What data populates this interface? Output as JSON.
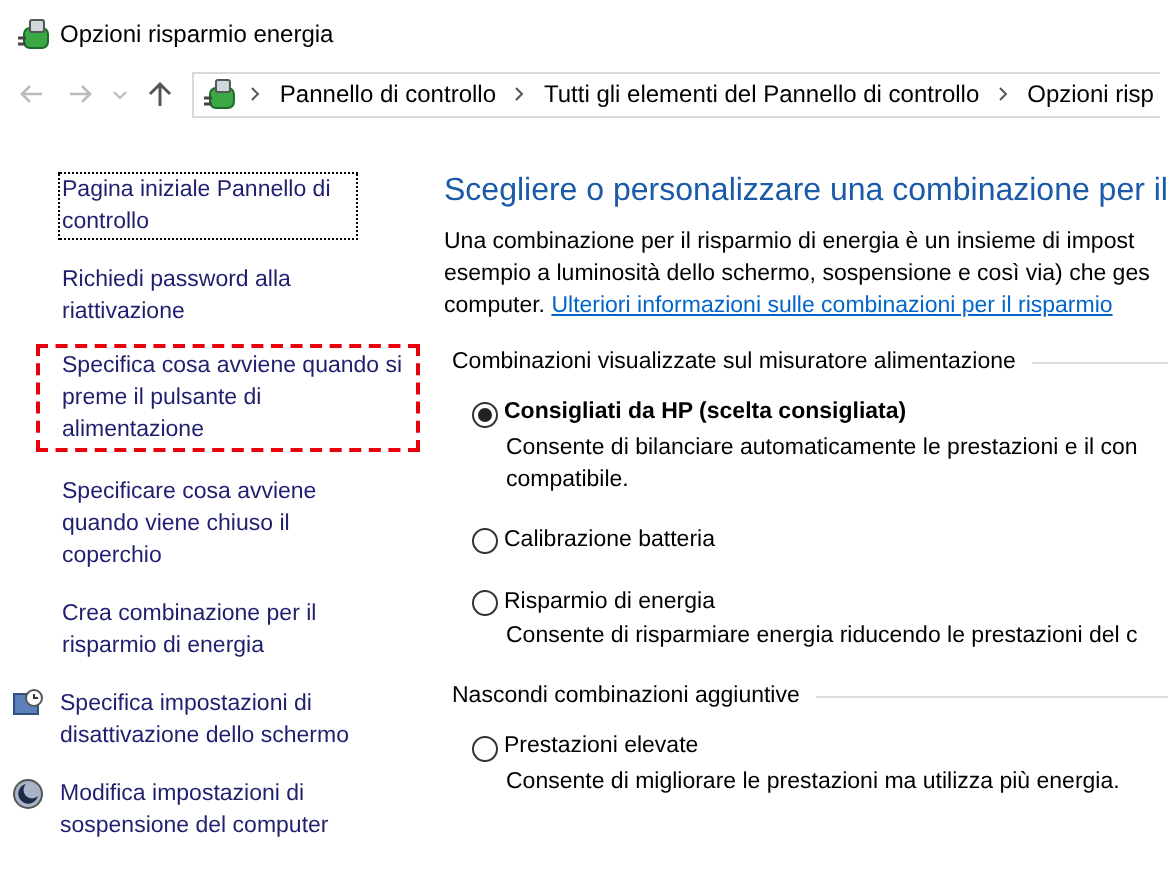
{
  "window": {
    "title": "Opzioni risparmio energia"
  },
  "address_bar": {
    "crumbs": [
      "Pannello di controllo",
      "Tutti gli elementi del Pannello di controllo",
      "Opzioni risp"
    ]
  },
  "sidebar": {
    "items": [
      {
        "kind": "plain",
        "label": "Pagina iniziale Pannello di controllo",
        "focused": true,
        "highlighted": false
      },
      {
        "kind": "plain",
        "label": "Richiedi password alla riattivazione",
        "focused": false,
        "highlighted": false
      },
      {
        "kind": "plain",
        "label": "Specifica cosa avviene quando si preme il pulsante di alimentazione",
        "focused": false,
        "highlighted": true
      },
      {
        "kind": "plain",
        "label": "Specificare cosa avviene quando viene chiuso il coperchio",
        "focused": false,
        "highlighted": false
      },
      {
        "kind": "plain",
        "label": "Crea combinazione per il risparmio di energia",
        "focused": false,
        "highlighted": false
      },
      {
        "kind": "display",
        "label": "Specifica impostazioni di disattivazione dello schermo",
        "focused": false,
        "highlighted": false
      },
      {
        "kind": "sleep",
        "label": "Modifica impostazioni di sospensione del computer",
        "focused": false,
        "highlighted": false
      }
    ]
  },
  "main": {
    "heading": "Scegliere o personalizzare una combinazione per il",
    "intro_lines": [
      "Una combinazione per il risparmio di energia è un insieme di impost",
      "esempio a luminosità dello schermo, sospensione e così via) che ges"
    ],
    "intro_last": "computer.",
    "intro_link": "Ulteriori informazioni sulle combinazioni per il risparmio",
    "groups": [
      {
        "title": "Combinazioni visualizzate sul misuratore alimentazione",
        "plans": [
          {
            "name": "Consigliati da HP (scelta consigliata)",
            "selected": true,
            "description": [
              "Consente di bilanciare automaticamente le prestazioni e il con",
              "compatibile."
            ]
          },
          {
            "name": "Calibrazione batteria",
            "selected": false
          },
          {
            "name": "Risparmio di energia",
            "selected": false,
            "description": [
              "Consente di risparmiare energia riducendo le prestazioni del c"
            ]
          }
        ]
      },
      {
        "title": "Nascondi combinazioni aggiuntive",
        "plans": [
          {
            "name": "Prestazioni elevate",
            "selected": false,
            "description": [
              "Consente di migliorare le prestazioni ma utilizza più energia."
            ]
          }
        ]
      }
    ]
  }
}
